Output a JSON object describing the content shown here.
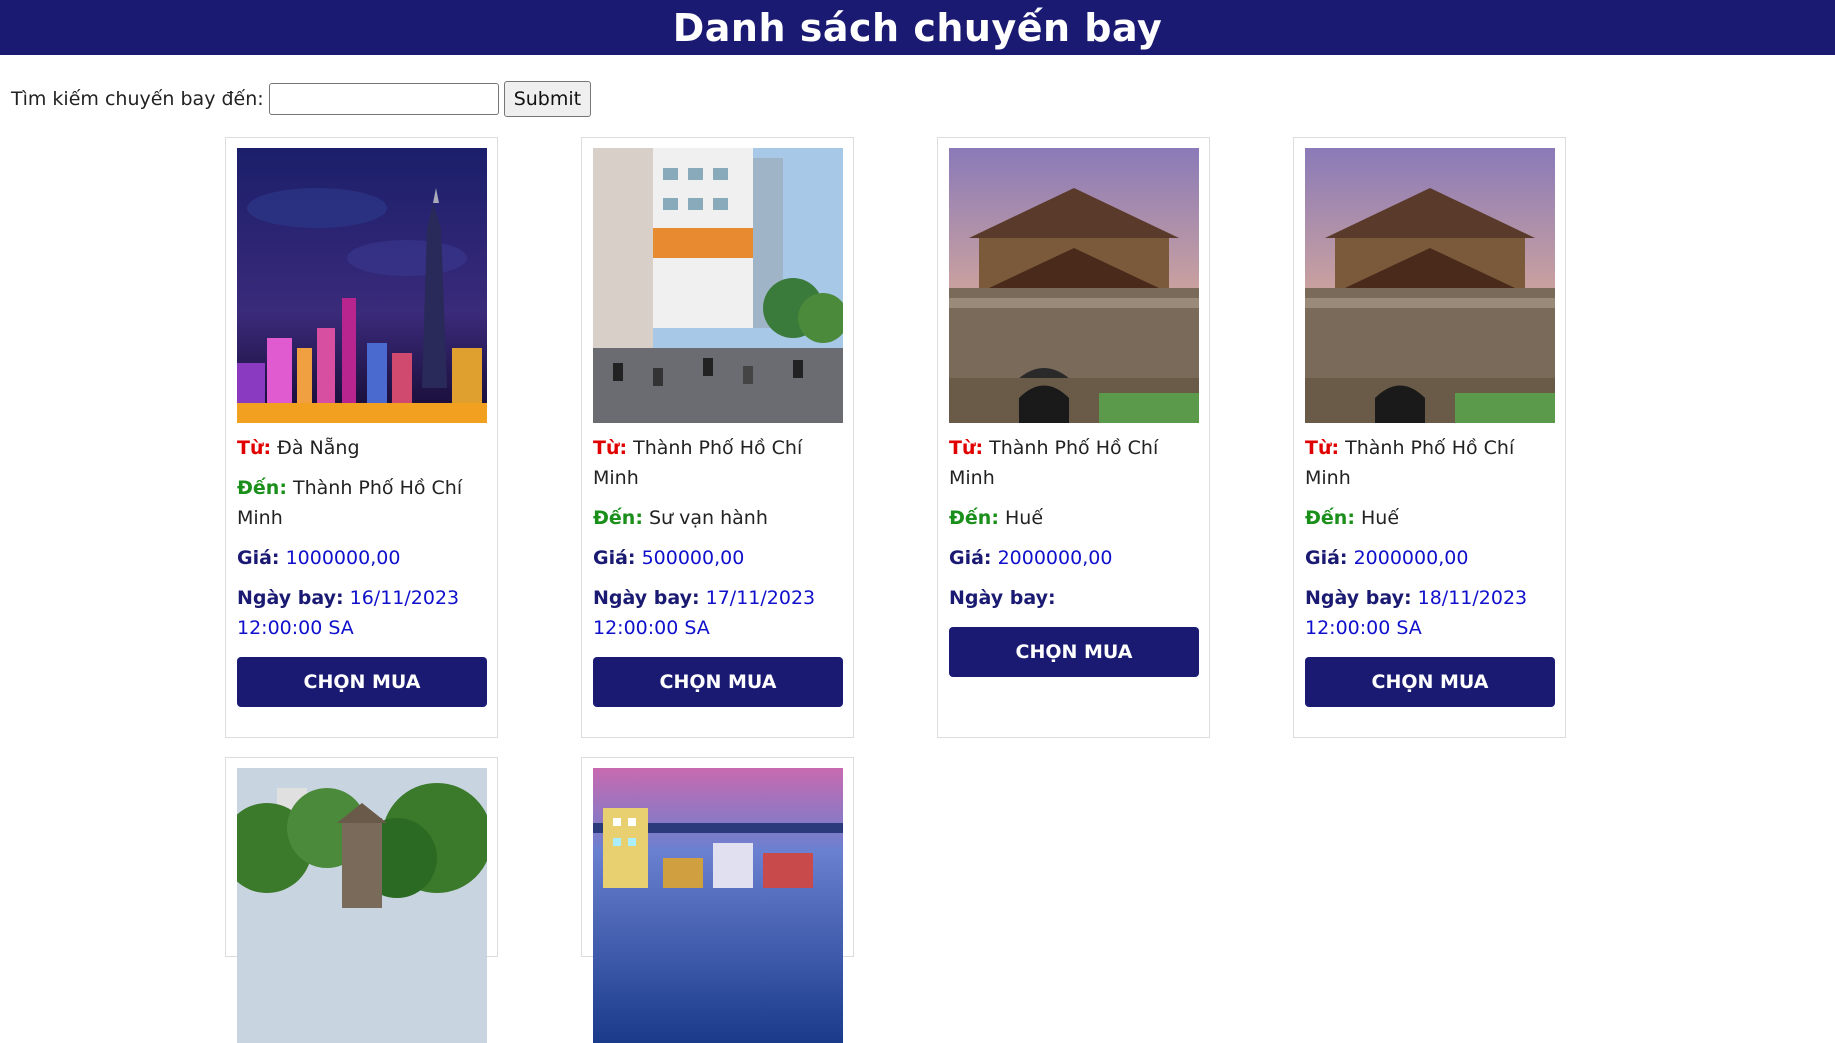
{
  "header": {
    "title": "Danh sách chuyến bay"
  },
  "search": {
    "label": "Tìm kiếm chuyến bay đến:",
    "value": "",
    "placeholder": "",
    "submit_label": "Submit"
  },
  "labels": {
    "from": "Từ:",
    "to": "Đến:",
    "price": "Giá:",
    "date": "Ngày bay:",
    "buy": "CHỌN MUA"
  },
  "flights": [
    {
      "from": "Đà Nẵng",
      "to": "Thành Phố Hồ Chí Minh",
      "price": "1000000,00",
      "date": "16/11/2023 12:00:00 SA",
      "image": "city-night-skyline"
    },
    {
      "from": "Thành Phố Hồ Chí Minh",
      "to": "Sư vạn hành",
      "price": "500000,00",
      "date": "17/11/2023 12:00:00 SA",
      "image": "street-scene"
    },
    {
      "from": "Thành Phố Hồ Chí Minh",
      "to": "Huế",
      "price": "2000000,00",
      "date": "",
      "image": "hue-citadel-gate"
    },
    {
      "from": "Thành Phố Hồ Chí Minh",
      "to": "Huế",
      "price": "2000000,00",
      "date": "18/11/2023 12:00:00 SA",
      "image": "hue-citadel-gate"
    },
    {
      "image": "lake-tower-trees"
    },
    {
      "image": "city-dusk-skyline"
    }
  ],
  "colors": {
    "header_bg": "#1a1a73",
    "from_label": "#e00000",
    "to_label": "#1a8f1a",
    "value_blue": "#1010cc"
  }
}
